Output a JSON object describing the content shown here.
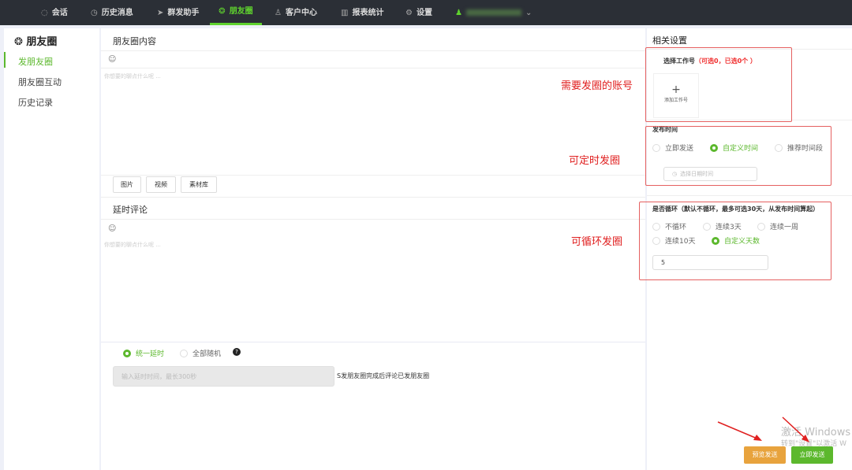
{
  "topnav": [
    {
      "icon": "chat-icon",
      "label": "会话"
    },
    {
      "icon": "clock-icon",
      "label": "历史消息"
    },
    {
      "icon": "send-icon",
      "label": "群发助手"
    },
    {
      "icon": "moments-icon",
      "label": "朋友圈",
      "active": true
    },
    {
      "icon": "user-icon",
      "label": "客户中心"
    },
    {
      "icon": "bar-chart-icon",
      "label": "报表统计"
    },
    {
      "icon": "gear-icon",
      "label": "设置"
    }
  ],
  "sidebar": {
    "title": "朋友圈",
    "items": [
      "发朋友圈",
      "朋友圈互动",
      "历史记录"
    ]
  },
  "content": {
    "title": "朋友圈内容",
    "placeholder": "你想要的聊点什么呢 ...",
    "tools": [
      "图片",
      "视频",
      "素材库"
    ]
  },
  "comment": {
    "title": "延时评论",
    "placeholder": "你想要的聊点什么呢 ...",
    "options": [
      "统一延时",
      "全部随机"
    ],
    "selected": "统一延时",
    "delay_placeholder": "输入延时时间，最长300秒",
    "delay_suffix": "S发朋友圈完成后评论已发朋友圈"
  },
  "settings": {
    "title": "相关设置",
    "account": {
      "label": "选择工作号",
      "hint": "（可选0，已选0个 ）",
      "add_label": "添加工作号"
    },
    "publish_time": {
      "label": "发布时间",
      "options": [
        "立即发送",
        "自定义时间",
        "推荐时间段"
      ],
      "selected": "自定义时间",
      "date_placeholder": "选择日期时间"
    },
    "loop": {
      "label": "是否循环（默认不循环，最多可选30天，从发布时间算起）",
      "options": [
        "不循环",
        "连续3天",
        "连续一周",
        "连续10天",
        "自定义天数"
      ],
      "selected": "自定义天数",
      "days": "5"
    }
  },
  "annotations": [
    "需要发圈的账号",
    "可定时发圈",
    "可循环发圈"
  ],
  "actions": {
    "preview": "预览发送",
    "send": "立即发送"
  },
  "watermark": {
    "line1": "激活 Windows",
    "line2": "转到\"设置\"以激活 W"
  },
  "colors": {
    "accent": "#5cb82d",
    "topbar": "#2b2f36",
    "preview": "#e8a33d",
    "annotation": "#e02020"
  }
}
